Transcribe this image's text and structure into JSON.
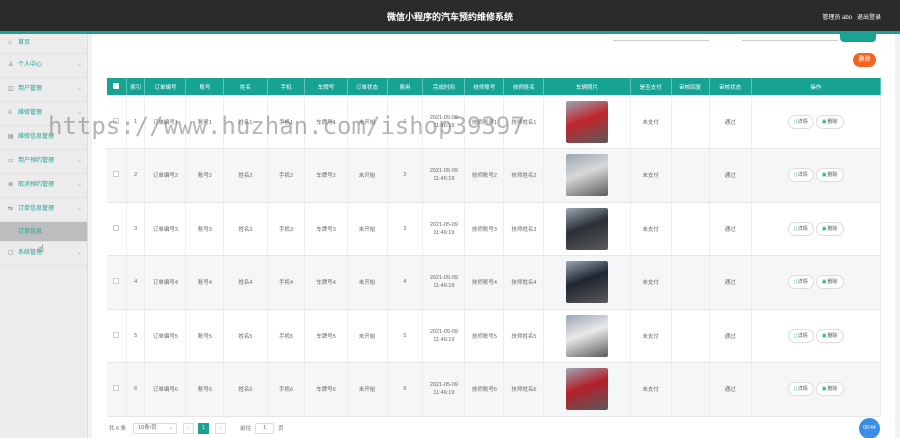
{
  "header": {
    "title": "微信小程序的汽车预约维修系统",
    "admin": "管理员 abo",
    "logout": "退出登录"
  },
  "sidebar": {
    "items": [
      {
        "label": "首页",
        "icon": "home-icon",
        "glyph": "⌂",
        "chevron": ""
      },
      {
        "label": "个人中心",
        "icon": "user-icon",
        "glyph": "♙",
        "chevron": "⌄"
      },
      {
        "label": "用户管理",
        "icon": "shield-icon",
        "glyph": "◫",
        "chevron": "⌄"
      },
      {
        "label": "维修管理",
        "icon": "list-icon",
        "glyph": "≡",
        "chevron": "⌄"
      },
      {
        "label": "维修信息管理",
        "icon": "card-icon",
        "glyph": "▤",
        "chevron": ""
      },
      {
        "label": "用户预约管理",
        "icon": "folder-icon",
        "glyph": "▭",
        "chevron": "⌄"
      },
      {
        "label": "取消预约管理",
        "icon": "cancel-icon",
        "glyph": "⊗",
        "chevron": "⌄"
      },
      {
        "label": "订单信息管理",
        "icon": "order-icon",
        "glyph": "⇆",
        "chevron": "⌄"
      }
    ],
    "sub_item": "订单信息",
    "last_item": {
      "label": "系统管理",
      "icon": "chat-icon",
      "glyph": "▢",
      "chevron": "⌄"
    }
  },
  "table": {
    "headers": [
      "索引",
      "订单编号",
      "账号",
      "姓名",
      "手机",
      "车牌号",
      "订单状态",
      "费用",
      "完成时间",
      "技师账号",
      "技师姓名",
      "车辆照片",
      "是否支付",
      "审核回复",
      "审核状态",
      "操作"
    ],
    "rows": [
      {
        "index": "1",
        "order": "订单编号1",
        "account": "账号1",
        "name": "姓名1",
        "phone": "手机1",
        "plate": "车牌号1",
        "status": "未开始",
        "fee": "1",
        "time": "2021-05-09 11:46:19",
        "tech_account": "技师账号1",
        "tech_name": "技师姓名1",
        "paid": "未支付",
        "reply": "",
        "review": "通过"
      },
      {
        "index": "2",
        "order": "订单编号2",
        "account": "账号2",
        "name": "姓名2",
        "phone": "手机2",
        "plate": "车牌号2",
        "status": "未开始",
        "fee": "2",
        "time": "2021-05-09 11:46:19",
        "tech_account": "技师账号2",
        "tech_name": "技师姓名2",
        "paid": "未支付",
        "reply": "",
        "review": "通过"
      },
      {
        "index": "3",
        "order": "订单编号3",
        "account": "账号3",
        "name": "姓名3",
        "phone": "手机3",
        "plate": "车牌号3",
        "status": "未开始",
        "fee": "3",
        "time": "2021-05-09 11:46:19",
        "tech_account": "技师账号3",
        "tech_name": "技师姓名3",
        "paid": "未支付",
        "reply": "",
        "review": "通过"
      },
      {
        "index": "4",
        "order": "订单编号4",
        "account": "账号4",
        "name": "姓名4",
        "phone": "手机4",
        "plate": "车牌号4",
        "status": "未开始",
        "fee": "4",
        "time": "2021-05-09 11:46:19",
        "tech_account": "技师账号4",
        "tech_name": "技师姓名4",
        "paid": "未支付",
        "reply": "",
        "review": "通过"
      },
      {
        "index": "5",
        "order": "订单编号5",
        "account": "账号5",
        "name": "姓名5",
        "phone": "手机5",
        "plate": "车牌号5",
        "status": "未开始",
        "fee": "5",
        "time": "2021-05-09 11:46:19",
        "tech_account": "技师账号5",
        "tech_name": "技师姓名5",
        "paid": "未支付",
        "reply": "",
        "review": "通过"
      },
      {
        "index": "6",
        "order": "订单编号6",
        "account": "账号6",
        "name": "姓名6",
        "phone": "手机6",
        "plate": "车牌号6",
        "status": "未开始",
        "fee": "6",
        "time": "2021-05-09 11:46:19",
        "tech_account": "技师账号6",
        "tech_name": "技师姓名6",
        "paid": "未支付",
        "reply": "",
        "review": "通过"
      }
    ],
    "car_colors": [
      "#c0262c",
      "#d8d8d8",
      "#2b2f36",
      "#1f2530",
      "#e9e9ea",
      "#b3202a"
    ],
    "detail_label": "详情",
    "delete_label": "删除"
  },
  "pager": {
    "total": "共 6 条",
    "page_size": "10条/页",
    "current": "1",
    "prev": "‹",
    "next": "›",
    "goto": "前往",
    "goto_value": "1",
    "page_unit": "页"
  },
  "float_time": "00:44",
  "watermark": "https://www.huzhan.com/ishop39397",
  "colors": {
    "accent": "#1aa394",
    "danger": "#f5641e",
    "topbar": "#2b2b2b"
  }
}
